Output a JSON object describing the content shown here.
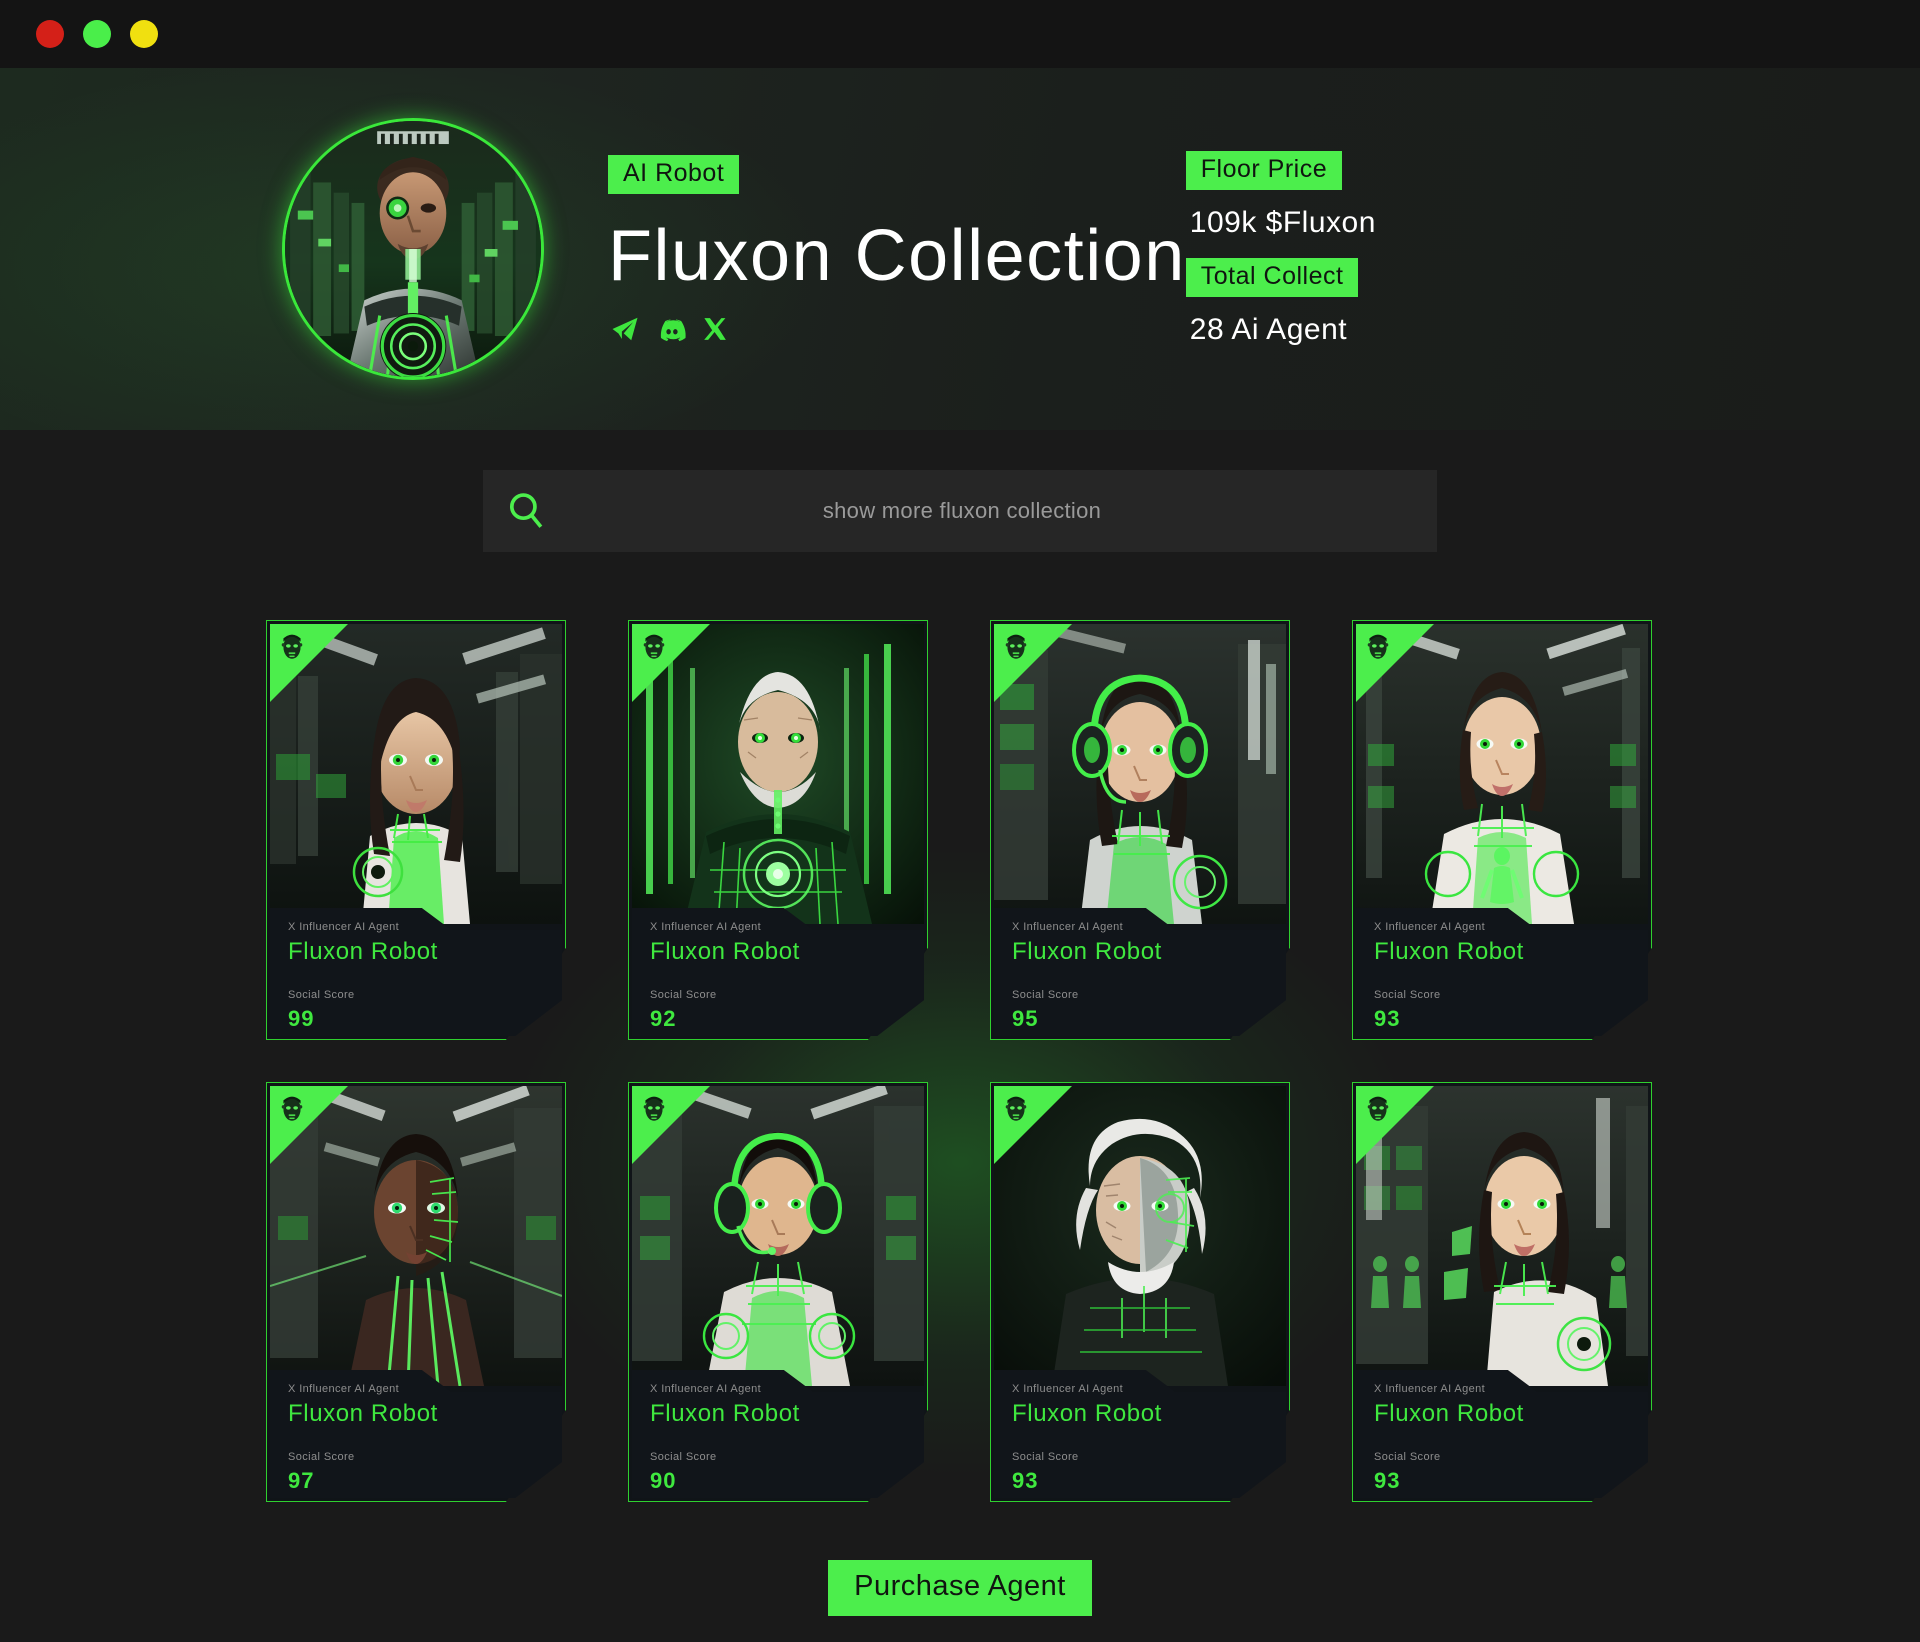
{
  "window": {
    "controls": [
      {
        "name": "close",
        "color": "#d42018"
      },
      {
        "name": "minimize",
        "color": "#4aee4a"
      },
      {
        "name": "maximize",
        "color": "#f0e010"
      }
    ]
  },
  "header": {
    "avatar_alt": "cyborg-portrait-avatar",
    "category_badge": "AI Robot",
    "title": "Fluxon Collection",
    "socials": [
      {
        "name": "telegram-icon",
        "label": "Telegram"
      },
      {
        "name": "discord-icon",
        "label": "Discord"
      },
      {
        "name": "x-icon",
        "label": "X"
      }
    ],
    "stats": [
      {
        "badge": "Floor Price",
        "value": "109k $Fluxon"
      },
      {
        "badge": "Total Collect",
        "value": "28 Ai Agent"
      }
    ],
    "accent_color": "#4cee4c",
    "title_color": "#ffffff"
  },
  "search": {
    "icon": "search-icon",
    "placeholder": "show more fluxon collection",
    "value": ""
  },
  "grid": {
    "card_label": "X Influencer AI Agent",
    "score_label": "Social Score",
    "badge_icon": "android-head-icon",
    "cards": [
      {
        "id": 1,
        "label": "X Influencer AI Agent",
        "name": "Fluxon Robot",
        "score_label": "Social Score",
        "score": "99",
        "portrait": "female-dark-hair-corridor"
      },
      {
        "id": 2,
        "label": "X Influencer AI Agent",
        "name": "Fluxon Robot",
        "score_label": "Social Score",
        "score": "92",
        "portrait": "elder-male-circuit-core"
      },
      {
        "id": 3,
        "label": "X Influencer AI Agent",
        "name": "Fluxon Robot",
        "score_label": "Social Score",
        "score": "95",
        "portrait": "female-headset-operator"
      },
      {
        "id": 4,
        "label": "X Influencer AI Agent",
        "name": "Fluxon Robot",
        "score_label": "Social Score",
        "score": "93",
        "portrait": "female-white-armor"
      },
      {
        "id": 5,
        "label": "X Influencer AI Agent",
        "name": "Fluxon Robot",
        "score_label": "Social Score",
        "score": "97",
        "portrait": "male-split-face-circuit"
      },
      {
        "id": 6,
        "label": "X Influencer AI Agent",
        "name": "Fluxon Robot",
        "score_label": "Social Score",
        "score": "90",
        "portrait": "male-headset-operator"
      },
      {
        "id": 7,
        "label": "X Influencer AI Agent",
        "name": "Fluxon Robot",
        "score_label": "Social Score",
        "score": "93",
        "portrait": "elder-male-white-hair"
      },
      {
        "id": 8,
        "label": "X Influencer AI Agent",
        "name": "Fluxon Robot",
        "score_label": "Social Score",
        "score": "93",
        "portrait": "female-green-hologram"
      }
    ]
  },
  "footer": {
    "purchase_label": "Purchase Agent"
  }
}
